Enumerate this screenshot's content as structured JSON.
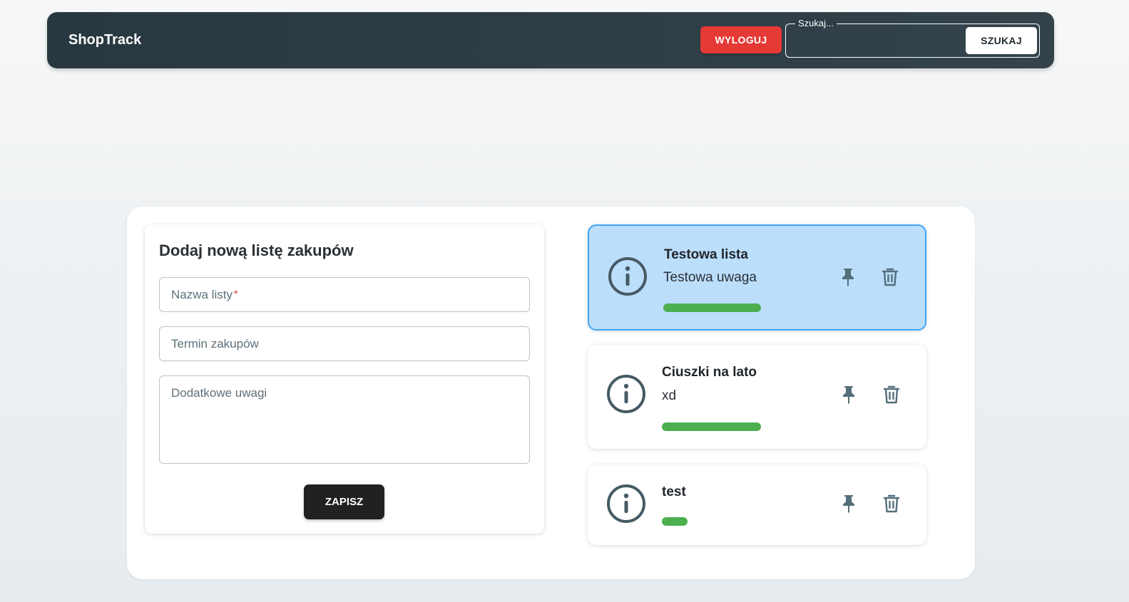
{
  "header": {
    "brand": "ShopTrack",
    "logout_label": "WYLOGUJ",
    "search_label": "Szukaj...",
    "search_value": "",
    "search_button": "SZUKAJ"
  },
  "form": {
    "title": "Dodaj nową listę zakupów",
    "name_label": "Nazwa listy",
    "name_required_mark": "*",
    "date_label": "Termin zakupów",
    "notes_label": "Dodatkowe uwagi",
    "save_label": "ZAPISZ"
  },
  "lists": [
    {
      "title": "Testowa lista",
      "note": "Testowa uwaga",
      "selected": true,
      "progress_bar": "full"
    },
    {
      "title": "Ciuszki na lato",
      "note": "xd",
      "selected": false,
      "progress_bar": "full"
    },
    {
      "title": "test",
      "note": "",
      "selected": false,
      "progress_bar": "short"
    }
  ],
  "icons": {
    "info": "info-circle-icon",
    "pin": "pin-icon",
    "delete": "trash-icon"
  },
  "colors": {
    "header_bg": "#2c3b43",
    "logout": "#e53935",
    "progress": "#4caf50",
    "selected_card": "#bbdefb",
    "selected_border": "#42a5f5",
    "icon": "#455a64"
  }
}
